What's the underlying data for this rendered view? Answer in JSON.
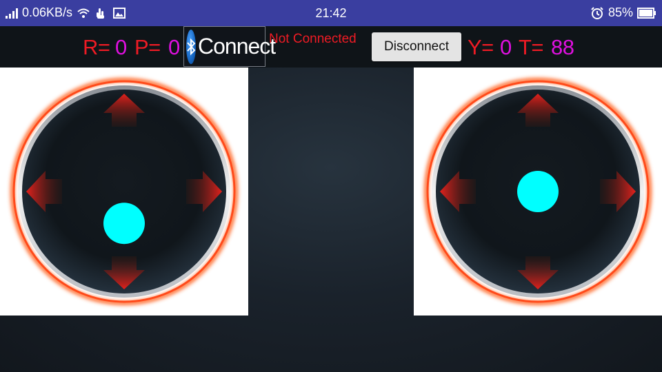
{
  "status_bar": {
    "network_speed": "0.06KB/s",
    "time": "21:42",
    "battery": "85%",
    "icons": [
      "signal-icon",
      "wifi-icon",
      "touch-gesture-icon",
      "image-icon",
      "alarm-icon",
      "battery-icon"
    ]
  },
  "controls": {
    "r_label": "R=",
    "r_value": "0",
    "p_label": "P=",
    "p_value": "0",
    "y_label": "Y=",
    "y_value": "0",
    "t_label": "T=",
    "t_value": "88",
    "connect_label": "Connect",
    "connection_status": "Not Connected",
    "disconnect_label": "Disconnect"
  },
  "joysticks": {
    "left": {
      "knob_x": 0.0,
      "knob_y": -0.33
    },
    "right": {
      "knob_x": 0.0,
      "knob_y": 0.0
    }
  },
  "colors": {
    "status_bar": "#3a3ea0",
    "label_red": "#ee1b24",
    "value_magenta": "#e010e0",
    "knob": "#00ffff",
    "ring": "#ff4a1a"
  }
}
